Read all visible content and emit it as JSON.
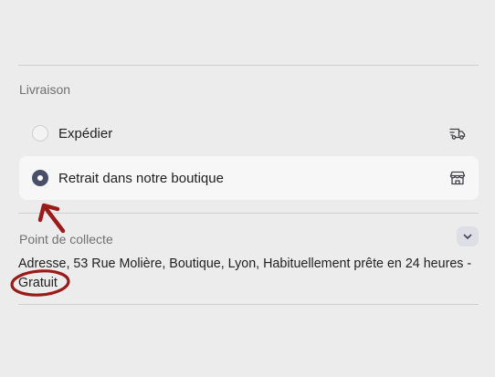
{
  "delivery": {
    "section_label": "Livraison",
    "options": [
      {
        "label": "Expédier",
        "icon": "truck-icon",
        "selected": false
      },
      {
        "label": "Retrait dans notre boutique",
        "icon": "store-icon",
        "selected": true
      }
    ]
  },
  "pickup": {
    "section_label": "Point de collecte",
    "address_text": "Adresse, 53 Rue Molière, Boutique, Lyon, Habituellement prête en 24 heures - Gratuit",
    "toggle_icon": "chevron-down-icon"
  },
  "colors": {
    "background": "#ececec",
    "selected_option_bg": "#f7f7f8",
    "radio_checked": "#4a4f69",
    "annotation_red": "#9b1b1b",
    "chevron_bg": "#dedfe6"
  }
}
